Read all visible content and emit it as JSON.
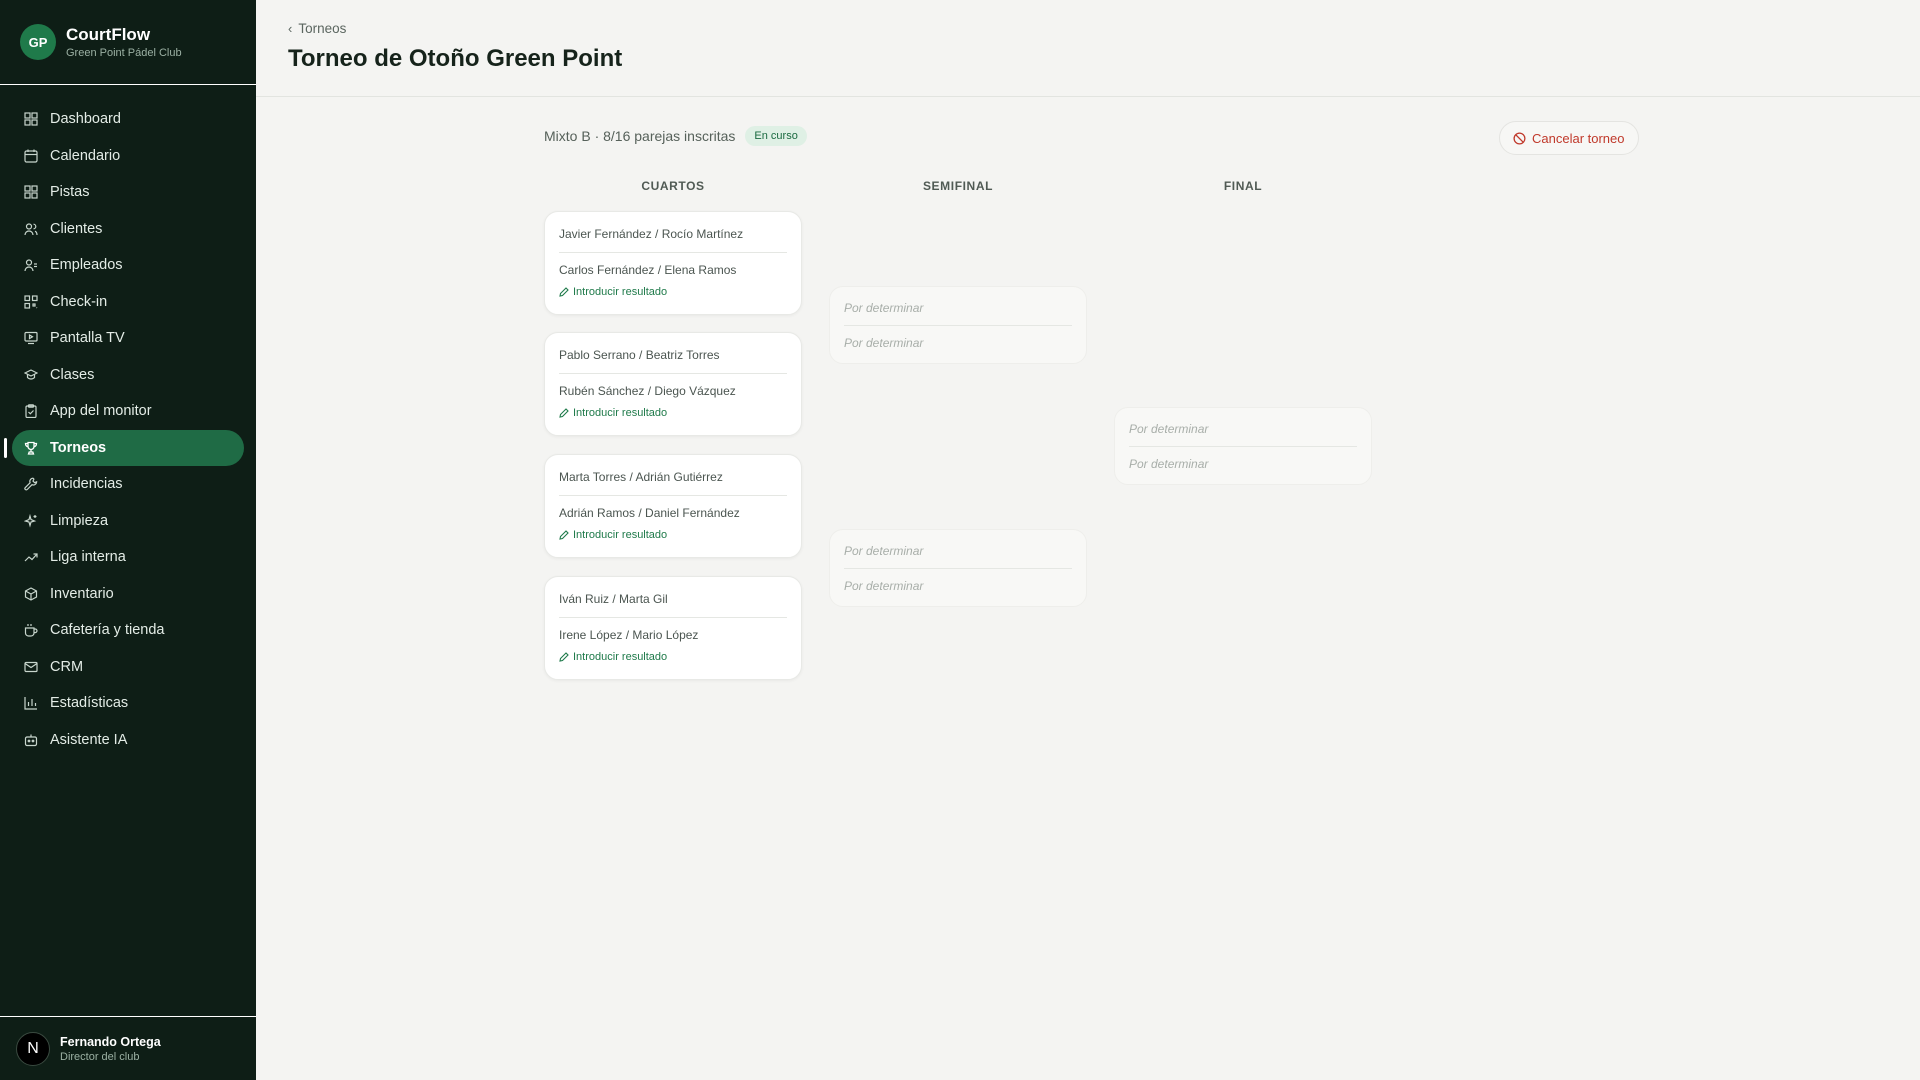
{
  "brand": {
    "initials": "GP",
    "name": "CourtFlow",
    "club": "Green Point Pádel Club"
  },
  "nav": [
    {
      "label": "Dashboard",
      "icon": "dashboard-icon"
    },
    {
      "label": "Calendario",
      "icon": "calendar-icon"
    },
    {
      "label": "Pistas",
      "icon": "grid-icon"
    },
    {
      "label": "Clientes",
      "icon": "users-icon"
    },
    {
      "label": "Empleados",
      "icon": "employee-icon"
    },
    {
      "label": "Check-in",
      "icon": "qr-icon"
    },
    {
      "label": "Pantalla TV",
      "icon": "tv-icon"
    },
    {
      "label": "Clases",
      "icon": "graduation-icon"
    },
    {
      "label": "App del monitor",
      "icon": "clipboard-icon"
    },
    {
      "label": "Torneos",
      "icon": "trophy-icon",
      "active": true
    },
    {
      "label": "Incidencias",
      "icon": "wrench-icon"
    },
    {
      "label": "Limpieza",
      "icon": "sparkle-icon"
    },
    {
      "label": "Liga interna",
      "icon": "trend-icon"
    },
    {
      "label": "Inventario",
      "icon": "box-icon"
    },
    {
      "label": "Cafetería y tienda",
      "icon": "coffee-icon"
    },
    {
      "label": "CRM",
      "icon": "mail-icon"
    },
    {
      "label": "Estadísticas",
      "icon": "bar-chart-icon"
    },
    {
      "label": "Asistente IA",
      "icon": "bot-icon"
    }
  ],
  "user": {
    "initial": "N",
    "name": "Fernando Ortega",
    "role": "Director del club"
  },
  "header": {
    "breadcrumb": "Torneos",
    "title": "Torneo de Otoño Green Point"
  },
  "tournament": {
    "info": "Mixto B · 8/16 parejas inscritas",
    "status": "En curso",
    "cancel_label": "Cancelar torneo"
  },
  "columns": {
    "quarters": "CUARTOS",
    "semis": "SEMIFINAL",
    "final": "FINAL"
  },
  "quarterfinals": [
    {
      "team1": "Javier Fernández / Rocío Martínez",
      "team2": "Carlos Fernández / Elena Ramos",
      "action": "Introducir resultado"
    },
    {
      "team1": "Pablo Serrano / Beatriz Torres",
      "team2": "Rubén Sánchez / Diego Vázquez",
      "action": "Introducir resultado"
    },
    {
      "team1": "Marta Torres / Adrián Gutiérrez",
      "team2": "Adrián Ramos / Daniel Fernández",
      "action": "Introducir resultado"
    },
    {
      "team1": "Iván Ruiz / Marta Gil",
      "team2": "Irene López / Mario López",
      "action": "Introducir resultado"
    }
  ],
  "semifinals": [
    {
      "team1": "Por determinar",
      "team2": "Por determinar"
    },
    {
      "team1": "Por determinar",
      "team2": "Por determinar"
    }
  ],
  "final": {
    "team1": "Por determinar",
    "team2": "Por determinar"
  }
}
